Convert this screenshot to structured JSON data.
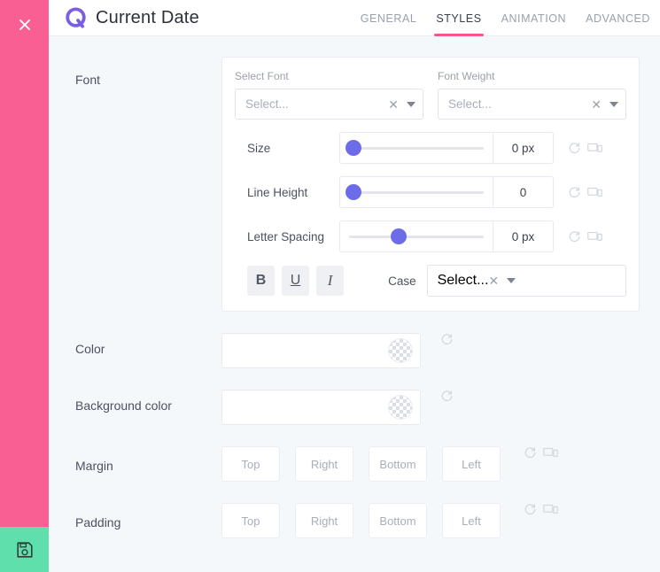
{
  "rail": {
    "close_icon": "close-icon",
    "save_icon": "save-floppy-icon",
    "accent_pink": "#fa5f93",
    "save_green": "#5fdfab"
  },
  "header": {
    "logo": "qubely-q-logo",
    "title": "Current Date",
    "tabs": [
      {
        "label": "GENERAL",
        "active": false
      },
      {
        "label": "STYLES",
        "active": true
      },
      {
        "label": "ANIMATION",
        "active": false
      },
      {
        "label": "ADVANCED",
        "active": false
      }
    ],
    "active_underline_color": "#f9558c"
  },
  "font_section": {
    "label": "Font",
    "select_font": {
      "label": "Select Font",
      "value": "",
      "placeholder": "Select..."
    },
    "font_weight": {
      "label": "Font Weight",
      "value": "",
      "placeholder": "Select..."
    },
    "sliders": [
      {
        "label": "Size",
        "value": "0 px",
        "thumb_percent": 3
      },
      {
        "label": "Line Height",
        "value": "0",
        "thumb_percent": 3
      },
      {
        "label": "Letter Spacing",
        "value": "0 px",
        "thumb_percent": 37
      }
    ],
    "style_buttons": [
      {
        "label": "B",
        "name": "bold"
      },
      {
        "label": "U",
        "name": "underline"
      },
      {
        "label": "I",
        "name": "italic"
      }
    ],
    "case": {
      "label": "Case",
      "value": "",
      "placeholder": "Select..."
    },
    "thumb_color": "#6c6ce8"
  },
  "color_rows": [
    {
      "label": "Color",
      "swatch": "transparent-checker"
    },
    {
      "label": "Background color",
      "swatch": "transparent-checker"
    }
  ],
  "box_rows": [
    {
      "label": "Margin",
      "inputs": [
        {
          "value": "",
          "placeholder": "Top"
        },
        {
          "value": "",
          "placeholder": "Right"
        },
        {
          "value": "",
          "placeholder": "Bottom"
        },
        {
          "value": "",
          "placeholder": "Left"
        }
      ]
    },
    {
      "label": "Padding",
      "inputs": [
        {
          "value": "",
          "placeholder": "Top"
        },
        {
          "value": "",
          "placeholder": "Right"
        },
        {
          "value": "",
          "placeholder": "Bottom"
        },
        {
          "value": "",
          "placeholder": "Left"
        }
      ]
    }
  ],
  "icons": {
    "reset": "reset-icon",
    "device": "device-icon",
    "clear": "clear-x-icon",
    "caret": "chevron-down-icon"
  }
}
